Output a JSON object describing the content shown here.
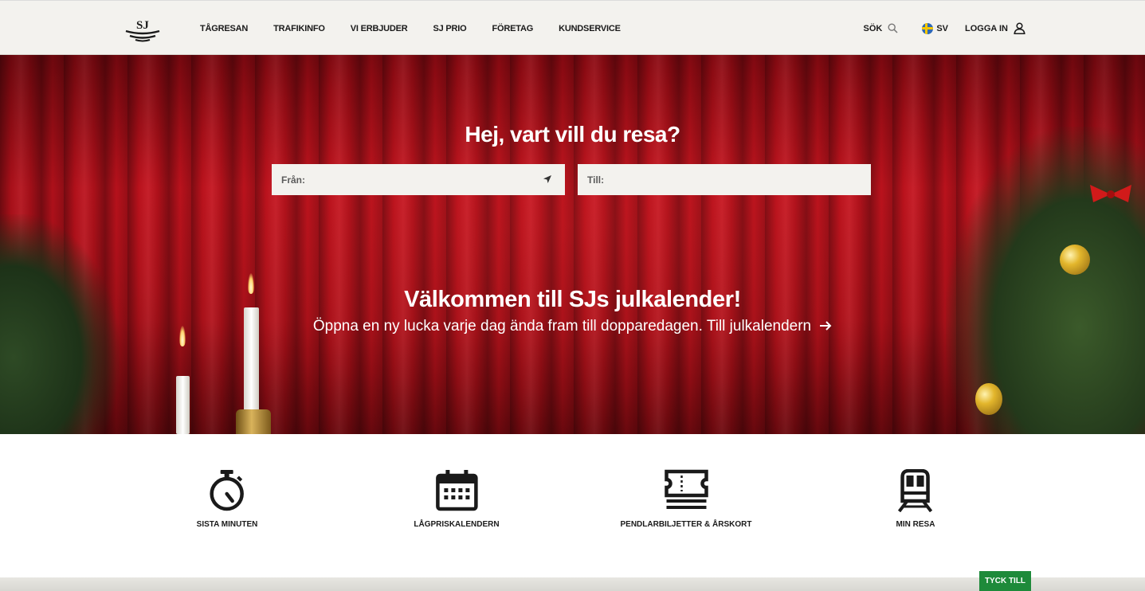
{
  "header": {
    "logo_text": "SJ",
    "nav": [
      {
        "label": "TÅGRESAN"
      },
      {
        "label": "TRAFIKINFO"
      },
      {
        "label": "VI ERBJUDER"
      },
      {
        "label": "SJ PRIO"
      },
      {
        "label": "FÖRETAG"
      },
      {
        "label": "KUNDSERVICE"
      }
    ],
    "search_label": "SÖK",
    "language_label": "SV",
    "login_label": "LOGGA IN"
  },
  "hero": {
    "title": "Hej, vart vill du resa?",
    "from_placeholder": "Från:",
    "to_placeholder": "Till:",
    "promo_title": "Välkommen till SJs julkalender!",
    "promo_text": "Öppna en ny lucka varje dag ända fram till dopparedagen. Till julkalendern"
  },
  "quick_links": [
    {
      "label": "SISTA MINUTEN",
      "icon": "stopwatch-icon"
    },
    {
      "label": "LÅGPRISKALENDERN",
      "icon": "calendar-icon"
    },
    {
      "label": "PENDLARBILJETTER & ÅRSKORT",
      "icon": "tickets-icon"
    },
    {
      "label": "MIN RESA",
      "icon": "train-icon"
    }
  ],
  "feedback_button": "TYCK TILL",
  "colors": {
    "header_bg": "#f3f2ee",
    "hero_red": "#c2121d",
    "feedback_green": "#1e8a3a",
    "text_dark": "#1a1a1a"
  }
}
